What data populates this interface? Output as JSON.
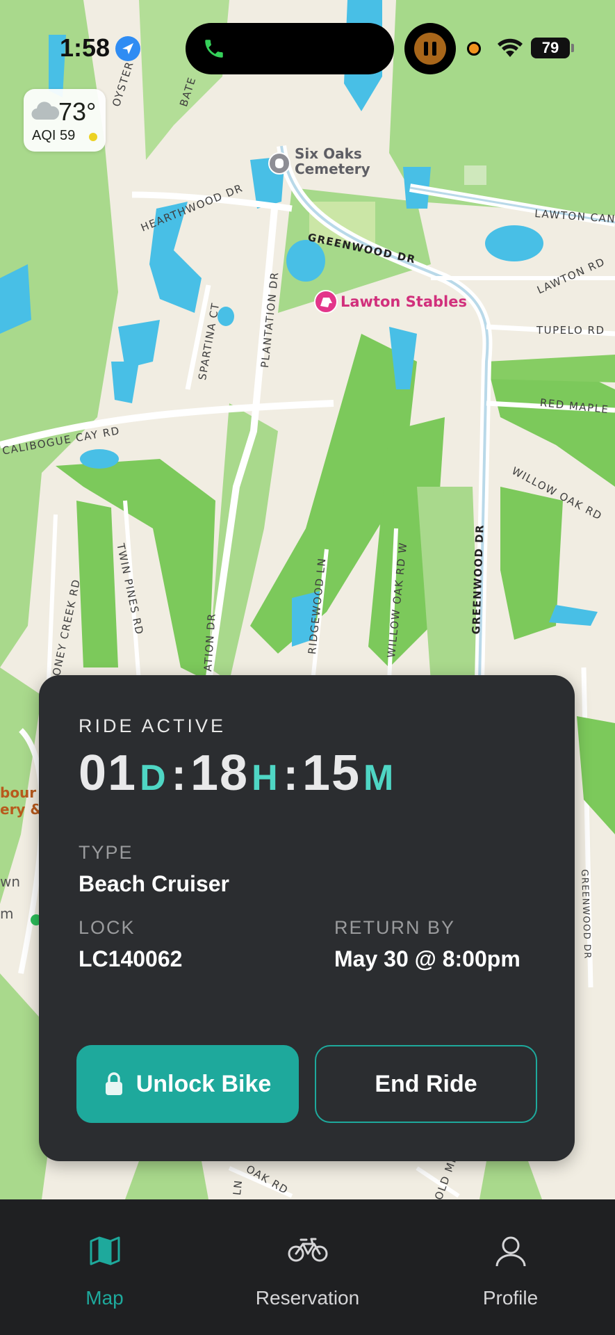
{
  "status_bar": {
    "time": "1:58",
    "battery": "79"
  },
  "weather": {
    "temperature": "73°",
    "aqi": "AQI 59"
  },
  "map": {
    "roads": [
      "OYSTER LA",
      "BATE",
      "HEARTHWOOD DR",
      "GREENWOOD DR",
      "LAWTON CAN",
      "LAWTON RD",
      "TUPELO RD",
      "RED MAPLE",
      "WILLOW OAK RD",
      "SPARTINA CT",
      "PLANTATION DR",
      "CALIBOGUE CAY RD",
      "TWIN PINES RD",
      "RIDGEWOOD LN",
      "WILLOW OAK RD W",
      "GREENWOOD DR",
      "ONEY CREEK RD",
      "ATION DR",
      "OAK RD",
      "OLD MI",
      "GREENWOOD DR",
      "LN"
    ],
    "pois": {
      "cemetery": "Six Oaks\nCemetery",
      "stables": "Lawton Stables",
      "harbour": "bour\nery &",
      "left_edge_1": "wn",
      "left_edge_2": "m"
    }
  },
  "ride": {
    "status": "RIDE ACTIVE",
    "days": "01",
    "days_unit": "D",
    "hours": "18",
    "hours_unit": "H",
    "minutes": "15",
    "minutes_unit": "M",
    "separator": ":",
    "type_label": "TYPE",
    "type_value": "Beach Cruiser",
    "lock_label": "LOCK",
    "lock_value": "LC140062",
    "return_label": "RETURN BY",
    "return_value": "May 30 @ 8:00pm",
    "unlock_button": "Unlock Bike",
    "end_button": "End Ride"
  },
  "tabs": [
    {
      "label": "Map",
      "icon": "map-icon",
      "active": true
    },
    {
      "label": "Reservation",
      "icon": "bike-icon",
      "active": false
    },
    {
      "label": "Profile",
      "icon": "person-icon",
      "active": false
    }
  ],
  "colors": {
    "accent": "#1ea99c",
    "card_bg": "#2b2d30",
    "tab_bar_bg": "#1f2022",
    "countdown_unit": "#4fd6c4"
  }
}
